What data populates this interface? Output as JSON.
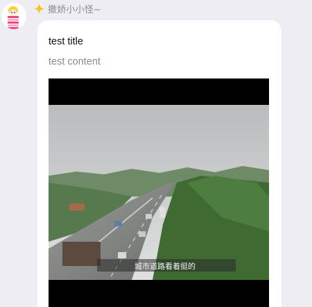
{
  "sender": {
    "name": "撒娇小小怪~",
    "badge_icon": "sparkle-star-icon",
    "avatar_icon": "cartoon-avatar-icon",
    "badge_color": "#f5c518"
  },
  "card": {
    "title": "test title",
    "content": "test content",
    "media_icon": "video-thumbnail-icon",
    "caption": "城市道路看着挺的"
  }
}
